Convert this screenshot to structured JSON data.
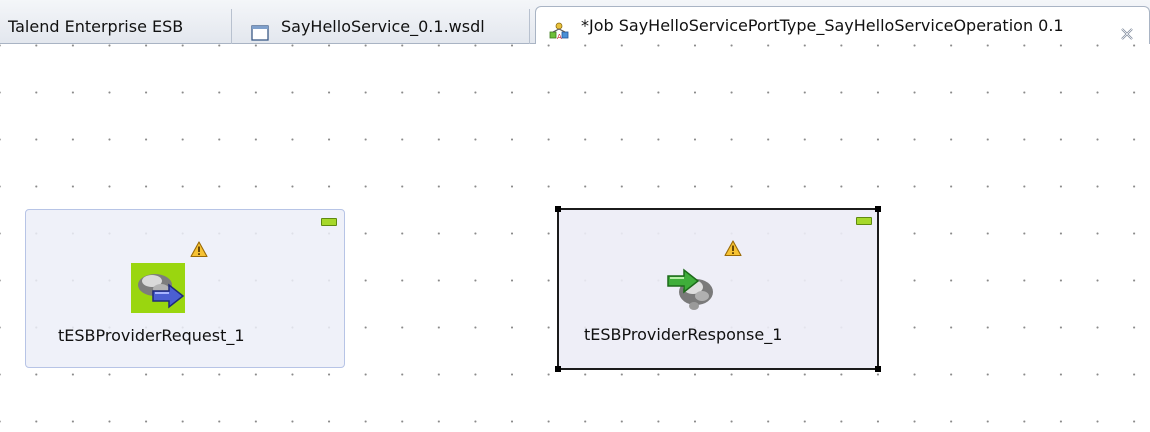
{
  "tabs": [
    {
      "label": "Talend Enterprise ESB",
      "icon": "none",
      "active": false
    },
    {
      "label": "SayHelloService_0.1.wsdl",
      "icon": "wsdl-file-icon",
      "active": false
    },
    {
      "label": "*Job SayHelloServicePortType_SayHelloServiceOperation 0.1",
      "icon": "job-icon",
      "active": true,
      "closable": true
    }
  ],
  "canvas": {
    "components": [
      {
        "label": "tESBProviderRequest_1",
        "icon": "esb-provider-request-icon",
        "warning": true,
        "selected": false
      },
      {
        "label": "tESBProviderResponse_1",
        "icon": "esb-provider-response-icon",
        "warning": true,
        "selected": true
      }
    ]
  },
  "colors": {
    "tab_border": "#a9b4c4",
    "component_fill": "#eceef8",
    "component_border": "#b7c4e6",
    "selection_border": "#1b1b1b",
    "minimize_green": "#a6d82a",
    "warning_yellow": "#f6c233"
  }
}
